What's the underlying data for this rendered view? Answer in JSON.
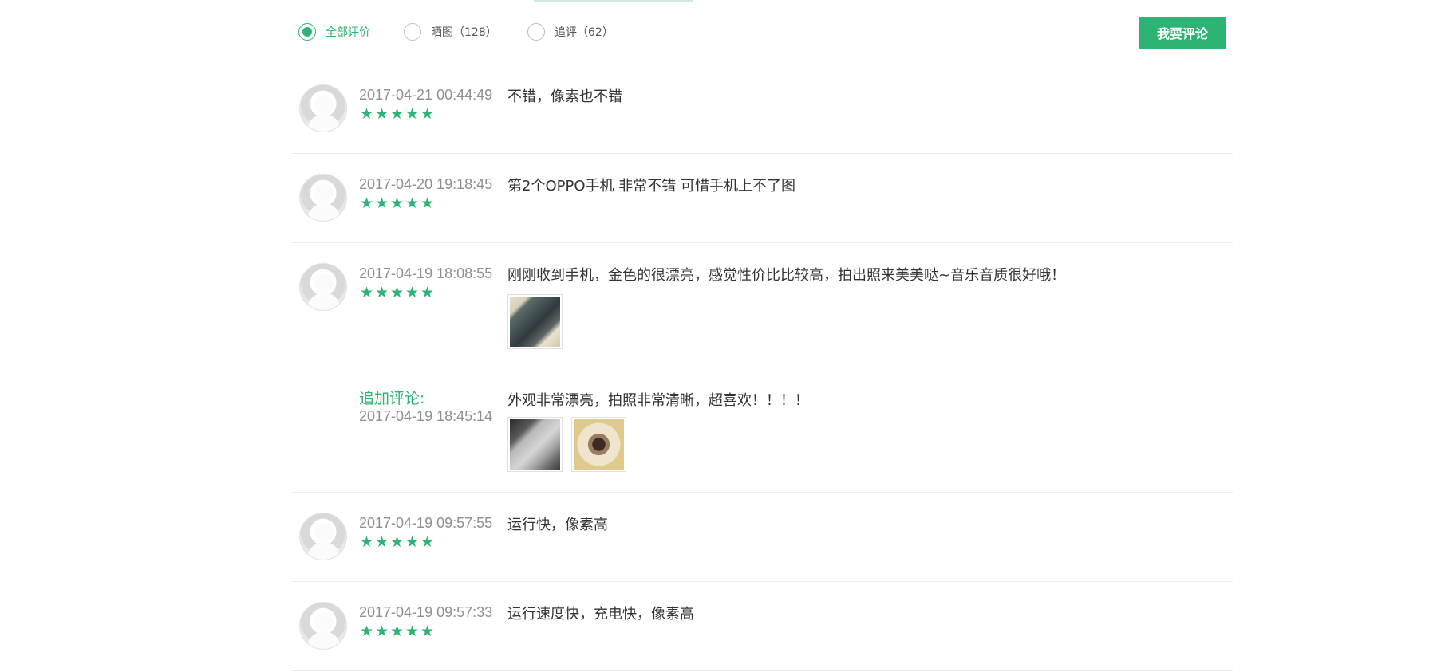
{
  "filters": [
    {
      "label": "全部评价",
      "checked": true
    },
    {
      "label": "晒图（128）",
      "checked": false
    },
    {
      "label": "追评（62）",
      "checked": false
    }
  ],
  "write_review_label": "我要评论",
  "reviews": [
    {
      "date": "2017-04-21 00:44:49",
      "rating": 5,
      "text": "不错，像素也不错"
    },
    {
      "date": "2017-04-20 19:18:45",
      "rating": 5,
      "text": "第2个OPPO手机 非常不错 可惜手机上不了图"
    },
    {
      "date": "2017-04-19 18:08:55",
      "rating": 5,
      "text": "刚刚收到手机，金色的很漂亮，感觉性价比比较高，拍出照来美美哒~音乐音质很好哦！"
    },
    {
      "add_label": "追加评论:",
      "date": "2017-04-19 18:45:14",
      "text": "外观非常漂亮，拍照非常清晰，超喜欢！！！！"
    },
    {
      "date": "2017-04-19 09:57:55",
      "rating": 5,
      "text": "运行快，像素高"
    },
    {
      "date": "2017-04-19 09:57:33",
      "rating": 5,
      "text": "运行速度快，充电快，像素高"
    }
  ],
  "accent_color": "#2db373"
}
